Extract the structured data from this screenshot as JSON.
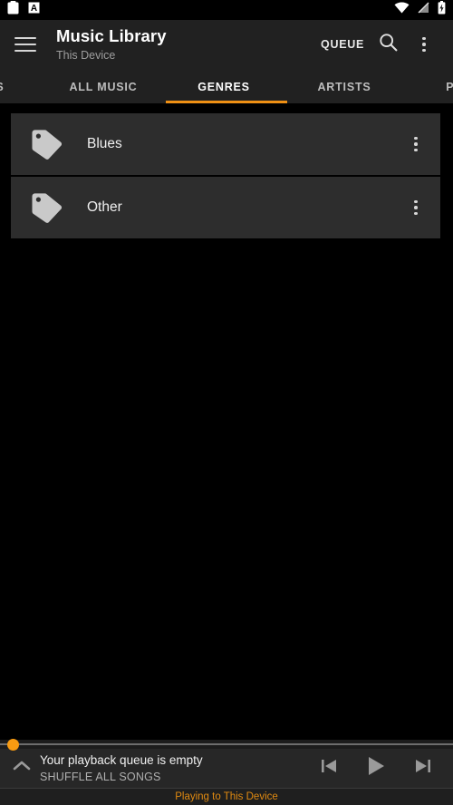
{
  "status_bar": {
    "left_icons": [
      "clipboard-icon",
      "letter-a-badge-icon"
    ],
    "right_icons": [
      "wifi-icon",
      "no-sim-icon",
      "battery-charging-icon"
    ]
  },
  "app_bar": {
    "menu_icon": "hamburger-menu-icon",
    "title": "Music Library",
    "subtitle": "This Device",
    "queue_label": "QUEUE",
    "search_icon": "search-icon",
    "overflow_icon": "more-vert-icon"
  },
  "tabs": {
    "items": [
      {
        "label": "S",
        "active": false
      },
      {
        "label": "ALL MUSIC",
        "active": false
      },
      {
        "label": "GENRES",
        "active": true
      },
      {
        "label": "ARTISTS",
        "active": false
      },
      {
        "label": "PL",
        "active": false
      }
    ],
    "active_index": 2,
    "indicator_color": "#ef9014"
  },
  "list": {
    "rows": [
      {
        "name": "Blues",
        "icon": "genre-tag-icon",
        "overflow_icon": "more-vert-icon"
      },
      {
        "name": "Other",
        "icon": "genre-tag-icon",
        "overflow_icon": "more-vert-icon"
      }
    ]
  },
  "player": {
    "seek_position_percent": 2,
    "expand_icon": "chevron-up-icon",
    "queue_status": "Your playback queue is empty",
    "shuffle_label": "SHUFFLE ALL SONGS",
    "previous_icon": "skip-previous-icon",
    "play_icon": "play-icon",
    "next_icon": "skip-next-icon",
    "cast_status": "Playing to This Device",
    "accent_color": "#f89b12",
    "cast_text_color": "#e08a11"
  }
}
